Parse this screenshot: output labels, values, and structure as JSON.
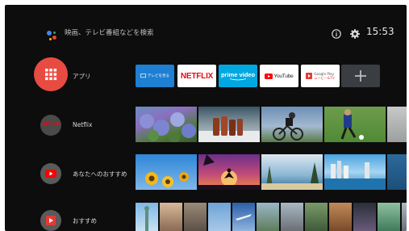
{
  "search": {
    "placeholder": "映画、テレビ番組などを検索"
  },
  "status": {
    "time": "15:53"
  },
  "rows": {
    "apps": {
      "label": "アプリ"
    },
    "netflix": {
      "label": "Netflix",
      "badge": "NETFLIX"
    },
    "recommended_for_you": {
      "label": "あなたへのおすすめ"
    },
    "recommended": {
      "label": "おすすめ"
    }
  },
  "apps": [
    {
      "name": "テレビを見る"
    },
    {
      "name": "NETFLIX"
    },
    {
      "name": "prime video"
    },
    {
      "name": "YouTube"
    },
    {
      "name": "Google Play",
      "sub": "ムービー&TV"
    },
    {
      "name": "add-app"
    }
  ],
  "colors": {
    "apps_accent": "#e84b42",
    "netflix_red": "#e50914",
    "prime_blue": "#00a8e1",
    "youtube_red": "#ff0000"
  }
}
